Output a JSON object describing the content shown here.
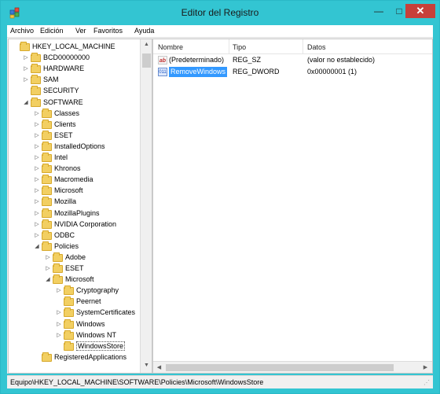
{
  "window": {
    "title": "Editor del Registro",
    "min": "—",
    "max": "□",
    "close": "✕"
  },
  "menu": [
    "Archivo",
    "Edición",
    "Ver",
    "Favoritos",
    "Ayuda"
  ],
  "tree": [
    {
      "label": "HKEY_LOCAL_MACHINE",
      "depth": 0,
      "exp": ""
    },
    {
      "label": "BCD00000000",
      "depth": 1,
      "exp": "▷"
    },
    {
      "label": "HARDWARE",
      "depth": 1,
      "exp": "▷"
    },
    {
      "label": "SAM",
      "depth": 1,
      "exp": "▷"
    },
    {
      "label": "SECURITY",
      "depth": 1,
      "exp": ""
    },
    {
      "label": "SOFTWARE",
      "depth": 1,
      "exp": "◢"
    },
    {
      "label": "Classes",
      "depth": 2,
      "exp": "▷"
    },
    {
      "label": "Clients",
      "depth": 2,
      "exp": "▷"
    },
    {
      "label": "ESET",
      "depth": 2,
      "exp": "▷"
    },
    {
      "label": "InstalledOptions",
      "depth": 2,
      "exp": "▷"
    },
    {
      "label": "Intel",
      "depth": 2,
      "exp": "▷"
    },
    {
      "label": "Khronos",
      "depth": 2,
      "exp": "▷"
    },
    {
      "label": "Macromedia",
      "depth": 2,
      "exp": "▷"
    },
    {
      "label": "Microsoft",
      "depth": 2,
      "exp": "▷"
    },
    {
      "label": "Mozilla",
      "depth": 2,
      "exp": "▷"
    },
    {
      "label": "MozillaPlugins",
      "depth": 2,
      "exp": "▷"
    },
    {
      "label": "NVIDIA Corporation",
      "depth": 2,
      "exp": "▷"
    },
    {
      "label": "ODBC",
      "depth": 2,
      "exp": "▷"
    },
    {
      "label": "Policies",
      "depth": 2,
      "exp": "◢"
    },
    {
      "label": "Adobe",
      "depth": 3,
      "exp": "▷"
    },
    {
      "label": "ESET",
      "depth": 3,
      "exp": "▷"
    },
    {
      "label": "Microsoft",
      "depth": 3,
      "exp": "◢"
    },
    {
      "label": "Cryptography",
      "depth": 4,
      "exp": "▷"
    },
    {
      "label": "Peernet",
      "depth": 4,
      "exp": ""
    },
    {
      "label": "SystemCertificates",
      "depth": 4,
      "exp": "▷"
    },
    {
      "label": "Windows",
      "depth": 4,
      "exp": "▷"
    },
    {
      "label": "Windows NT",
      "depth": 4,
      "exp": "▷"
    },
    {
      "label": "WindowsStore",
      "depth": 4,
      "exp": "",
      "selected": true
    },
    {
      "label": "RegisteredApplications",
      "depth": 2,
      "exp": ""
    }
  ],
  "list": {
    "headers": [
      "Nombre",
      "Tipo",
      "Datos"
    ],
    "rows": [
      {
        "icon": "ab",
        "kind": "sz",
        "name": "(Predeterminado)",
        "type": "REG_SZ",
        "data": "(valor no establecido)",
        "selected": false
      },
      {
        "icon": "011",
        "kind": "dw",
        "name": "RemoveWindows",
        "type": "REG_DWORD",
        "data": "0x00000001 (1)",
        "selected": true
      }
    ]
  },
  "status": "Equipo\\HKEY_LOCAL_MACHINE\\SOFTWARE\\Policies\\Microsoft\\WindowsStore",
  "colors": {
    "accent": "#33c5d2",
    "selection": "#3399ff",
    "close": "#c7403a"
  }
}
